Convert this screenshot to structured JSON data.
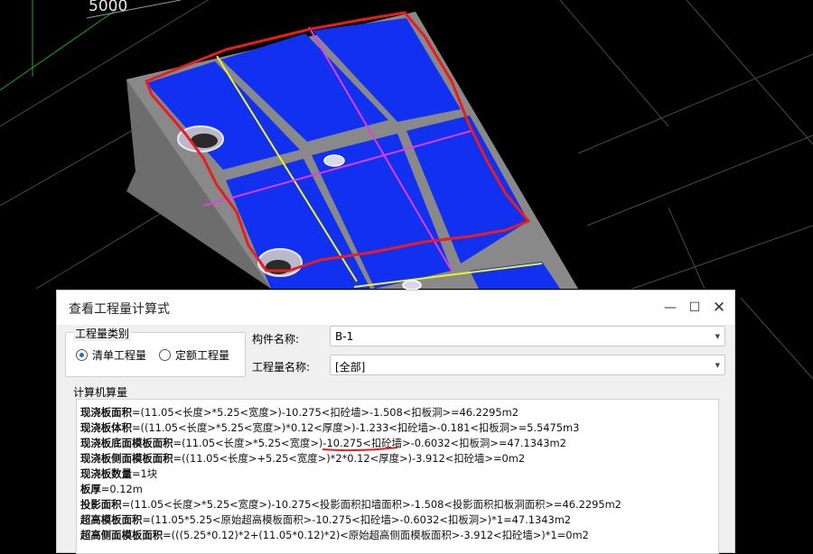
{
  "viewport": {
    "dimension_label": "5000",
    "colors": {
      "background": "#000000",
      "slab": "#1030f0",
      "beam_top": "#7a7a7a",
      "yellow_axis": "#f3f321",
      "magenta_axis": "#e23de6",
      "markup": "#e81e1e"
    }
  },
  "dialog": {
    "title": "查看工程量计算式",
    "category_group": {
      "legend": "工程量类别",
      "options": [
        {
          "label": "清单工程量",
          "selected": true
        },
        {
          "label": "定额工程量",
          "selected": false
        }
      ]
    },
    "component_name": {
      "label": "构件名称:",
      "value": "B-1"
    },
    "quantity_name": {
      "label": "工程量名称:",
      "value": "[全部]"
    },
    "calc_label": "计算机算量",
    "lines": [
      {
        "name": "现浇板面积",
        "expr": "=(11.05<长度>*5.25<宽度>)-10.275<扣砼墙>-1.508<扣板洞>=46.2295m2"
      },
      {
        "name": "现浇板体积",
        "expr": "=((11.05<长度>*5.25<宽度>)*0.12<厚度>)-1.233<扣砼墙>-0.181<扣板洞>=5.5475m3"
      },
      {
        "name": "现浇板底面模板面积",
        "expr": "=(11.05<长度>*5.25<宽度>)-10.275<扣砼墙>-0.6032<扣板洞>=47.1343m2"
      },
      {
        "name": "现浇板侧面模板面积",
        "expr": "=((11.05<长度>+5.25<宽度>)*2*0.12<厚度>)-3.912<扣砼墙>=0m2"
      },
      {
        "name": "现浇板数量",
        "expr": "=1块"
      },
      {
        "name": "板厚",
        "expr": "=0.12m"
      },
      {
        "name": "投影面积",
        "expr": "=(11.05<长度>*5.25<宽度>)-10.275<投影面积扣墙面积>-1.508<投影面积扣板洞面积>=46.2295m2"
      },
      {
        "name": "超高模板面积",
        "expr": "=(11.05*5.25<原始超高模板面积>-10.275<扣砼墙>-0.6032<扣板洞>)*1=47.1343m2"
      },
      {
        "name": "超高侧面模板面积",
        "expr": "=(((5.25*0.12)*2+(11.05*0.12)*2)<原始超高侧面模板面积>-3.912<扣砼墙>)*1=0m2"
      }
    ]
  }
}
